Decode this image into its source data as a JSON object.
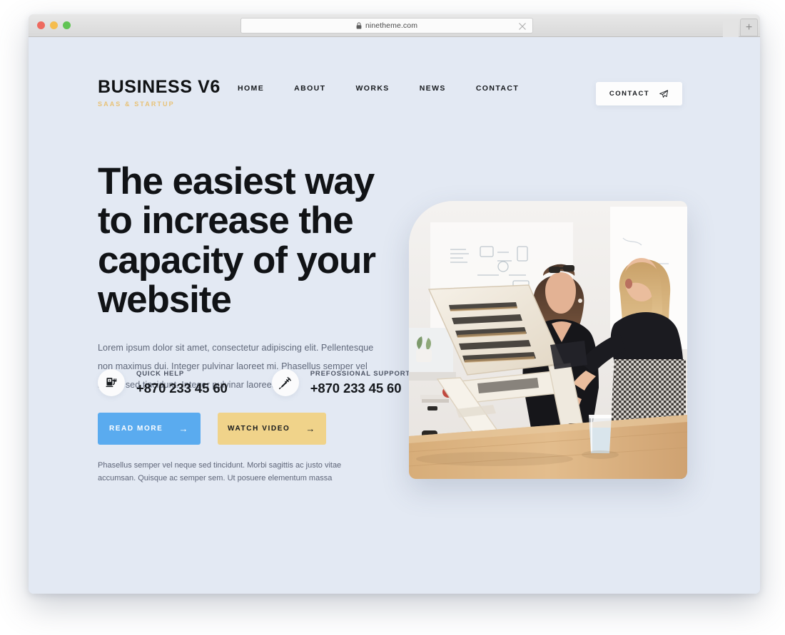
{
  "browser": {
    "url": "ninetheme.com",
    "lock_icon": "lock-icon",
    "close_icon": "close-icon",
    "newtab_label": "+",
    "traffic_lights": [
      "close-red",
      "minimize-yellow",
      "maximize-green"
    ]
  },
  "header": {
    "logo_title": "BUSINESS V6",
    "logo_subtitle": "SAAS & STARTUP",
    "nav": [
      {
        "label": "HOME"
      },
      {
        "label": "ABOUT"
      },
      {
        "label": "WORKS"
      },
      {
        "label": "NEWS"
      },
      {
        "label": "CONTACT"
      }
    ],
    "contact_button": {
      "label": "CONTACT",
      "icon": "paper-plane-icon"
    }
  },
  "hero": {
    "title": "The easiest way to increase the capacity of your website",
    "description": "Lorem ipsum dolor sit amet, consectetur adipiscing elit. Pellentesque non maximus dui. Integer pulvinar laoreet mi. Phasellus semper vel neque sed tincidunt. Integer pulvinar laoreet mi.",
    "buttons": [
      {
        "label": "READ MORE",
        "arrow": "→",
        "style": "primary"
      },
      {
        "label": "WATCH VIDEO",
        "arrow": "→",
        "style": "secondary"
      }
    ],
    "note": "Phasellus semper vel neque sed tincidunt. Morbi sagittis ac justo vitae accumsan. Quisque ac semper sem. Ut posuere elementum massa",
    "contacts": [
      {
        "icon": "charging-station-icon",
        "label": "QUICK HELP",
        "phone": "+870 233 45 60"
      },
      {
        "icon": "syringe-icon",
        "label": "PREFOSSIONAL SUPPORT",
        "phone": "+870 233 45 60"
      }
    ],
    "image_alt": "two-women-at-standing-desk-with-wooden-laptop-stand"
  },
  "colors": {
    "page_background": "#e3e9f3",
    "heading": "#111316",
    "body_text": "#60687a",
    "accent_blue": "#5aabef",
    "accent_gold": "#f0d38a",
    "logo_sub_gold": "#e8c277",
    "card_white": "#fdfdfd"
  }
}
